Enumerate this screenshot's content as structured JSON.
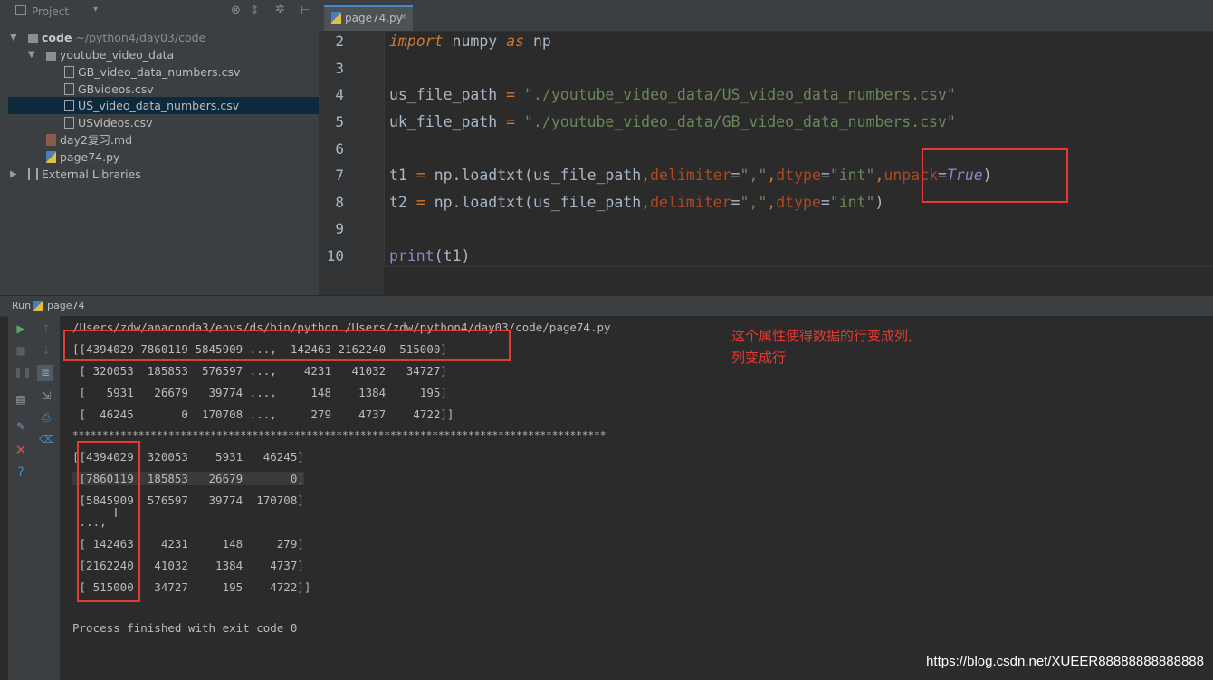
{
  "sidebar": {
    "header_title": "Project",
    "items": [
      {
        "label": "code",
        "suffix": " ~/python4/day03/code"
      },
      {
        "label": "youtube_video_data"
      },
      {
        "label": "GB_video_data_numbers.csv"
      },
      {
        "label": "GBvideos.csv"
      },
      {
        "label": "US_video_data_numbers.csv"
      },
      {
        "label": "USvideos.csv"
      },
      {
        "label": "day2复习.md"
      },
      {
        "label": "page74.py"
      },
      {
        "label": "External Libraries"
      }
    ]
  },
  "editor": {
    "tab_label": "page74.py",
    "line_numbers": [
      "2",
      "3",
      "4",
      "5",
      "6",
      "7",
      "8",
      "9",
      "10"
    ],
    "code": {
      "l2": {
        "kw_import": "import",
        "mod": " numpy ",
        "kw_as": "as",
        "alias": " np"
      },
      "l4": {
        "var": "us_file_path",
        "eq": " = ",
        "str": "\"./youtube_video_data/US_video_data_numbers.csv\""
      },
      "l5": {
        "var": "uk_file_path",
        "eq": " = ",
        "str": "\"./youtube_video_data/GB_video_data_numbers.csv\""
      },
      "l7": {
        "var": "t1",
        "eq": " = ",
        "call": "np.loadtxt(us_file_path",
        "c1": ",",
        "p1": "delimiter",
        "e1": "=",
        "s1": "\",\"",
        "c2": ",",
        "p2": "dtype",
        "e2": "=",
        "s2": "\"int\"",
        "c3": ",",
        "p3": "unpack",
        "e3": "=",
        "cst": "True",
        "close": ")"
      },
      "l8": {
        "var": "t2",
        "eq": " = ",
        "call": "np.loadtxt(us_file_path",
        "c1": ",",
        "p1": "delimiter",
        "e1": "=",
        "s1": "\",\"",
        "c2": ",",
        "p2": "dtype",
        "e2": "=",
        "s2": "\"int\"",
        "close": ")"
      },
      "l10": {
        "fn": "print",
        "rest": "(t1)"
      }
    }
  },
  "run": {
    "label": "Run",
    "config": "page74",
    "console_lines": [
      "/Users/zdw/anaconda3/envs/ds/bin/python /Users/zdw/python4/day03/code/page74.py",
      "[[4394029 7860119 5845909 ...,  142463 2162240  515000]",
      " [ 320053  185853  576597 ...,    4231   41032   34727]",
      " [   5931   26679   39774 ...,     148    1384     195]",
      " [  46245       0  170708 ...,     279    4737    4722]]",
      "*****************************************************************************************",
      "[[4394029  320053    5931   46245]",
      " [7860119  185853   26679       0]",
      " [5845909  576597   39774  170708]",
      " ...,",
      " [ 142463    4231     148     279]",
      " [2162240   41032    1384    4737]",
      " [ 515000   34727     195    4722]]",
      "",
      "Process finished with exit code 0"
    ],
    "annotation_line1": "这个属性使得数据的行变成列,",
    "annotation_line2": "列变成行"
  },
  "watermark": "https://blog.csdn.net/XUEER88888888888888",
  "colors": {
    "highlight": "#e53935",
    "keyword": "#cc7832",
    "string": "#6a8759",
    "param": "#aa4926",
    "builtin": "#8888c6"
  }
}
